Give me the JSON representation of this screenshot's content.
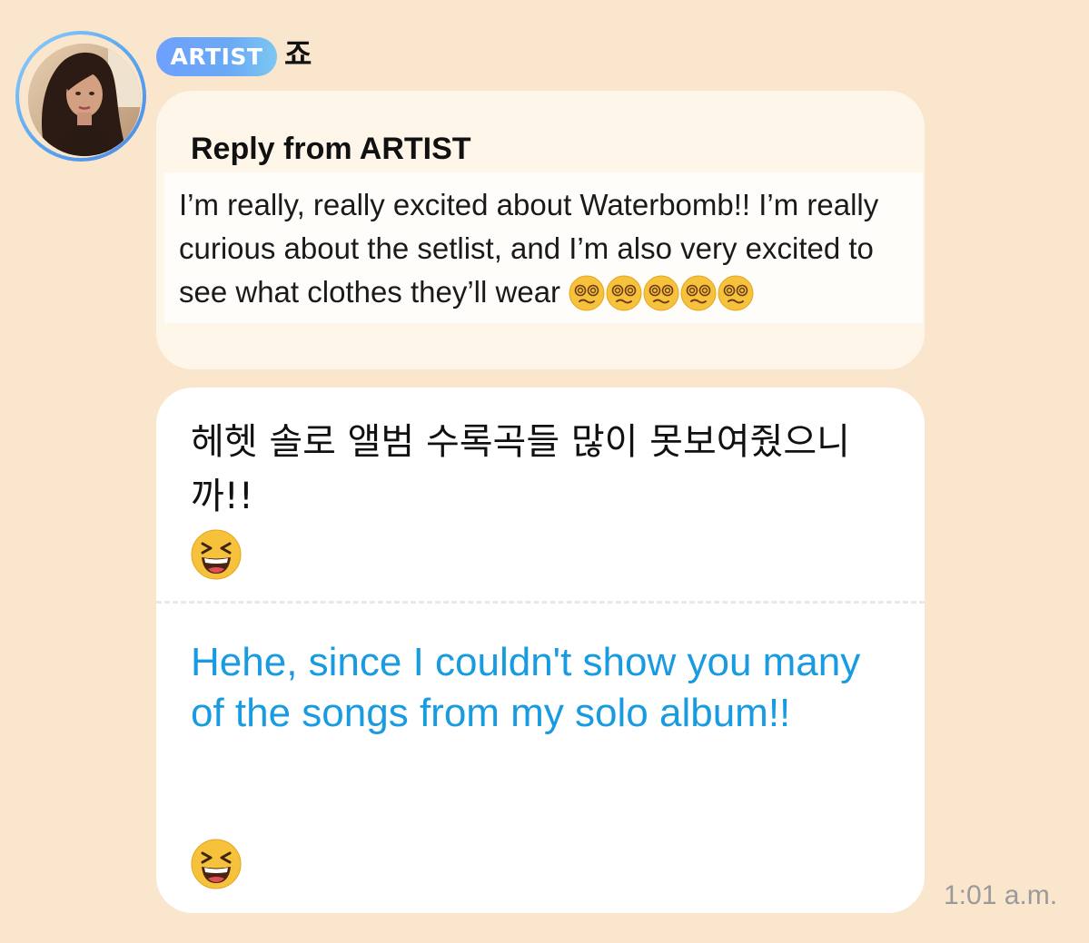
{
  "sender": {
    "badge": "ARTIST",
    "name": "죠"
  },
  "reply": {
    "heading": "Reply from ARTIST",
    "text": "I’m really, really excited about Waterbomb!! I’m really curious about the setlist, and I’m also very excited to see what clothes they’ll wear",
    "emoji_count": 5,
    "emoji_icon": "face-with-spiral-eyes-icon"
  },
  "message": {
    "korean": "헤헷 솔로 앨범 수록곡들 많이 못보여줬으니까!!",
    "translation": "Hehe, since I couldn't show you many of the songs from my solo album!!",
    "emoji_icon": "grinning-squinting-face-icon"
  },
  "timestamp": "1:01 a.m.",
  "colors": {
    "background": "#fae5cd",
    "badge": "#6aa9f5",
    "translation": "#189be0",
    "timestamp": "#9a9a9a"
  }
}
